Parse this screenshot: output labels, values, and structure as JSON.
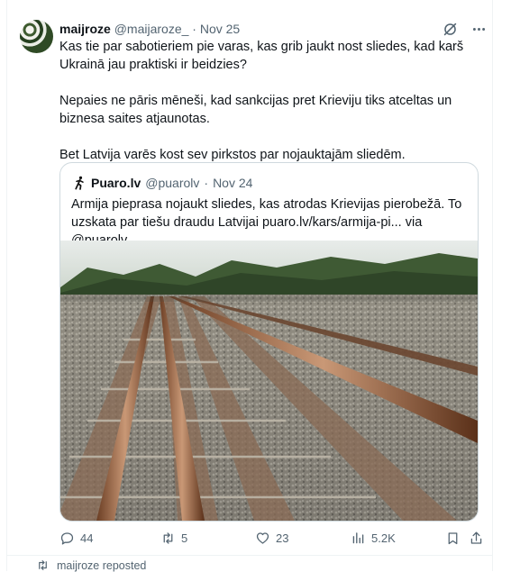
{
  "post": {
    "author_name": "maijroze",
    "author_handle": "@maijaroze_",
    "separator": "·",
    "date": "Nov 25",
    "paragraphs": [
      "Kas tie par sabotieriem pie varas, kas grib jaukt nost sliedes, kad karš Ukrainā jau praktiski ir beidzies?",
      "Nepaies ne pāris mēneši, kad sankcijas pret Krieviju tiks atceltas un biznesa saites atjaunotas.",
      "Bet Latvija varēs kost sev pirkstos par nojauktajām sliedēm."
    ]
  },
  "quote": {
    "author_name": "Puaro.lv",
    "author_handle": "@puarolv",
    "separator": "·",
    "date": "Nov 24",
    "text": "Armija pieprasa nojaukt sliedes, kas atrodas Krievijas pierobežā. To uzskata par tiešu draudu Latvijai puaro.lv/kars/armija-pi... via @puarolv",
    "image_alt": "railway tracks"
  },
  "actions": {
    "replies": "44",
    "reposts": "5",
    "likes": "23",
    "views": "5.2K"
  },
  "next_item": {
    "repost_label": "maijroze reposted"
  },
  "icons": [
    "grok-icon",
    "more-icon",
    "running-man-icon",
    "reply-icon",
    "repost-icon",
    "like-icon",
    "views-icon",
    "bookmark-icon",
    "share-icon"
  ]
}
